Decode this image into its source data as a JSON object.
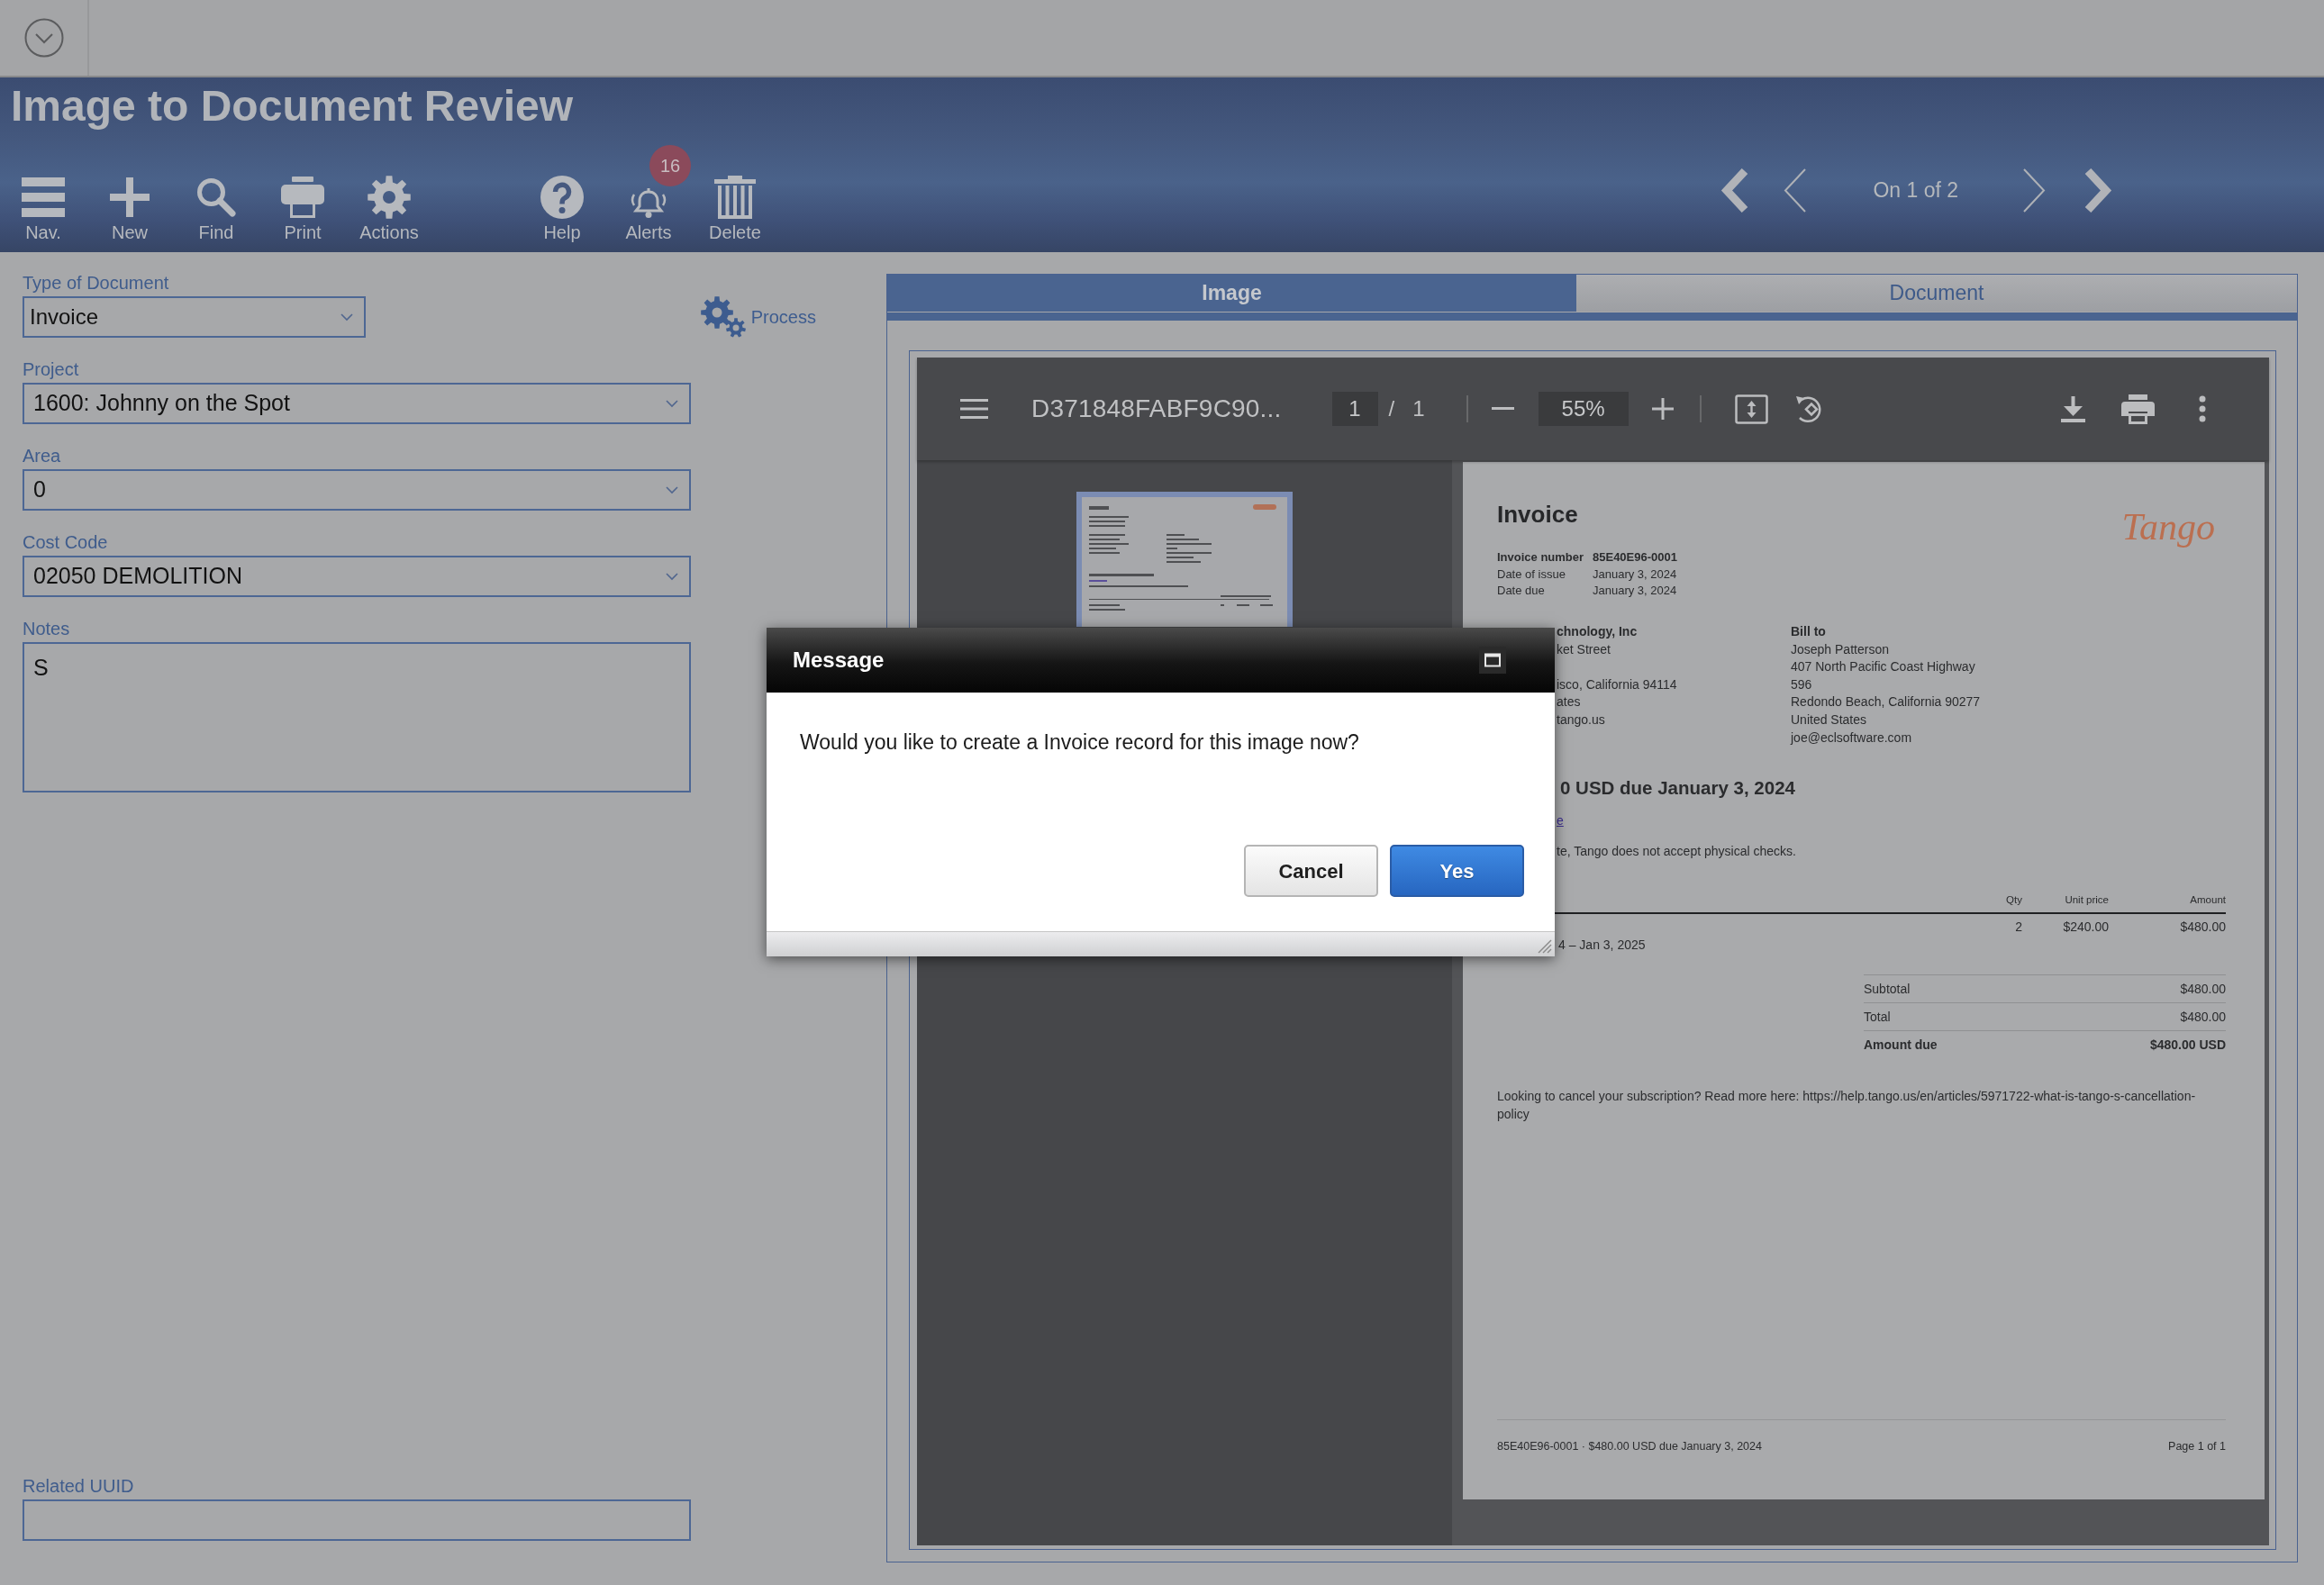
{
  "header": {
    "title": "Image to Document Review",
    "toolbar": {
      "groups": [
        {
          "buttons": [
            {
              "kind": "menu",
              "label": "Nav."
            },
            {
              "kind": "add",
              "label": "New"
            },
            {
              "kind": "search",
              "label": "Find"
            },
            {
              "kind": "print",
              "label": "Print"
            },
            {
              "kind": "gear",
              "label": "Actions"
            }
          ]
        },
        {
          "buttons": [
            {
              "kind": "help",
              "label": "Help"
            },
            {
              "kind": "bell",
              "label": "Alerts",
              "badge": "16"
            },
            {
              "kind": "trash",
              "label": "Delete"
            }
          ]
        }
      ]
    },
    "record_nav": {
      "position": "On 1 of 2"
    }
  },
  "form": {
    "fields": [
      {
        "kind": "select",
        "label": "Type of Document",
        "value": "Invoice"
      },
      {
        "kind": "select",
        "label": "Project",
        "value": "1600: Johnny on the Spot"
      },
      {
        "kind": "select",
        "label": "Area",
        "value": "0"
      },
      {
        "kind": "select",
        "label": "Cost Code",
        "value": "02050 DEMOLITION"
      },
      {
        "kind": "textarea",
        "label": "Notes",
        "value": "S"
      }
    ],
    "process_button": {
      "label": "Process"
    },
    "related_uuid": {
      "label": "Related UUID"
    }
  },
  "tabs": [
    {
      "label": "Image",
      "selected": true
    },
    {
      "label": "Document",
      "selected": false
    }
  ],
  "pdf_viewer": {
    "filename": "D371848FABF9C90...",
    "page_input": "1",
    "page_separator": "/",
    "page_count": "1",
    "zoom": "55%"
  },
  "document": {
    "title": "Invoice",
    "logo": "Tango",
    "details": [
      {
        "label": "Invoice number",
        "value": "85E40E96-0001",
        "strong": true
      },
      {
        "label": "Date of issue",
        "value": "January 3, 2024",
        "strong": false
      },
      {
        "label": "Date due",
        "value": "January 3, 2024",
        "strong": false
      }
    ],
    "sender": {
      "name": "chnology, Inc",
      "address_blocks": [
        [
          "ket Street"
        ],
        [
          "isco, California 94114",
          "ates",
          "tango.us"
        ]
      ]
    },
    "bill_to": {
      "heading": "Bill to",
      "lines": [
        "Joseph Patterson",
        "407 North Pacific Coast Highway",
        "596",
        "Redondo Beach, California 90277",
        "United States",
        "joe@eclsoftware.com"
      ]
    },
    "amount_heading": "0 USD due January 3, 2024",
    "link": "e",
    "note": "te, Tango does not accept physical checks.",
    "items": {
      "columns": [
        "Qty",
        "Unit price",
        "Amount"
      ],
      "rows": [
        {
          "period": "4 – Jan 3, 2025",
          "qty": "2",
          "unit_price": "$240.00",
          "amount": "$480.00"
        }
      ]
    },
    "totals": [
      {
        "label": "Subtotal",
        "value": "$480.00",
        "strong": false
      },
      {
        "label": "Total",
        "value": "$480.00",
        "strong": false
      },
      {
        "label": "Amount due",
        "value": "$480.00 USD",
        "strong": true
      }
    ],
    "footer_note": "Looking to cancel your subscription? Read more here: https://help.tango.us/en/articles/5971722-what-is-tango-s-cancellation-policy",
    "page_footer": {
      "summary": "85E40E96-0001 · $480.00 USD due January 3, 2024",
      "page_number": "Page 1 of 1"
    }
  },
  "dialog": {
    "title": "Message",
    "message": "Would you like to create a Invoice record for this image now?",
    "buttons": [
      {
        "kind": "cancel",
        "label": "Cancel"
      },
      {
        "kind": "confirm",
        "label": "Yes"
      }
    ]
  }
}
